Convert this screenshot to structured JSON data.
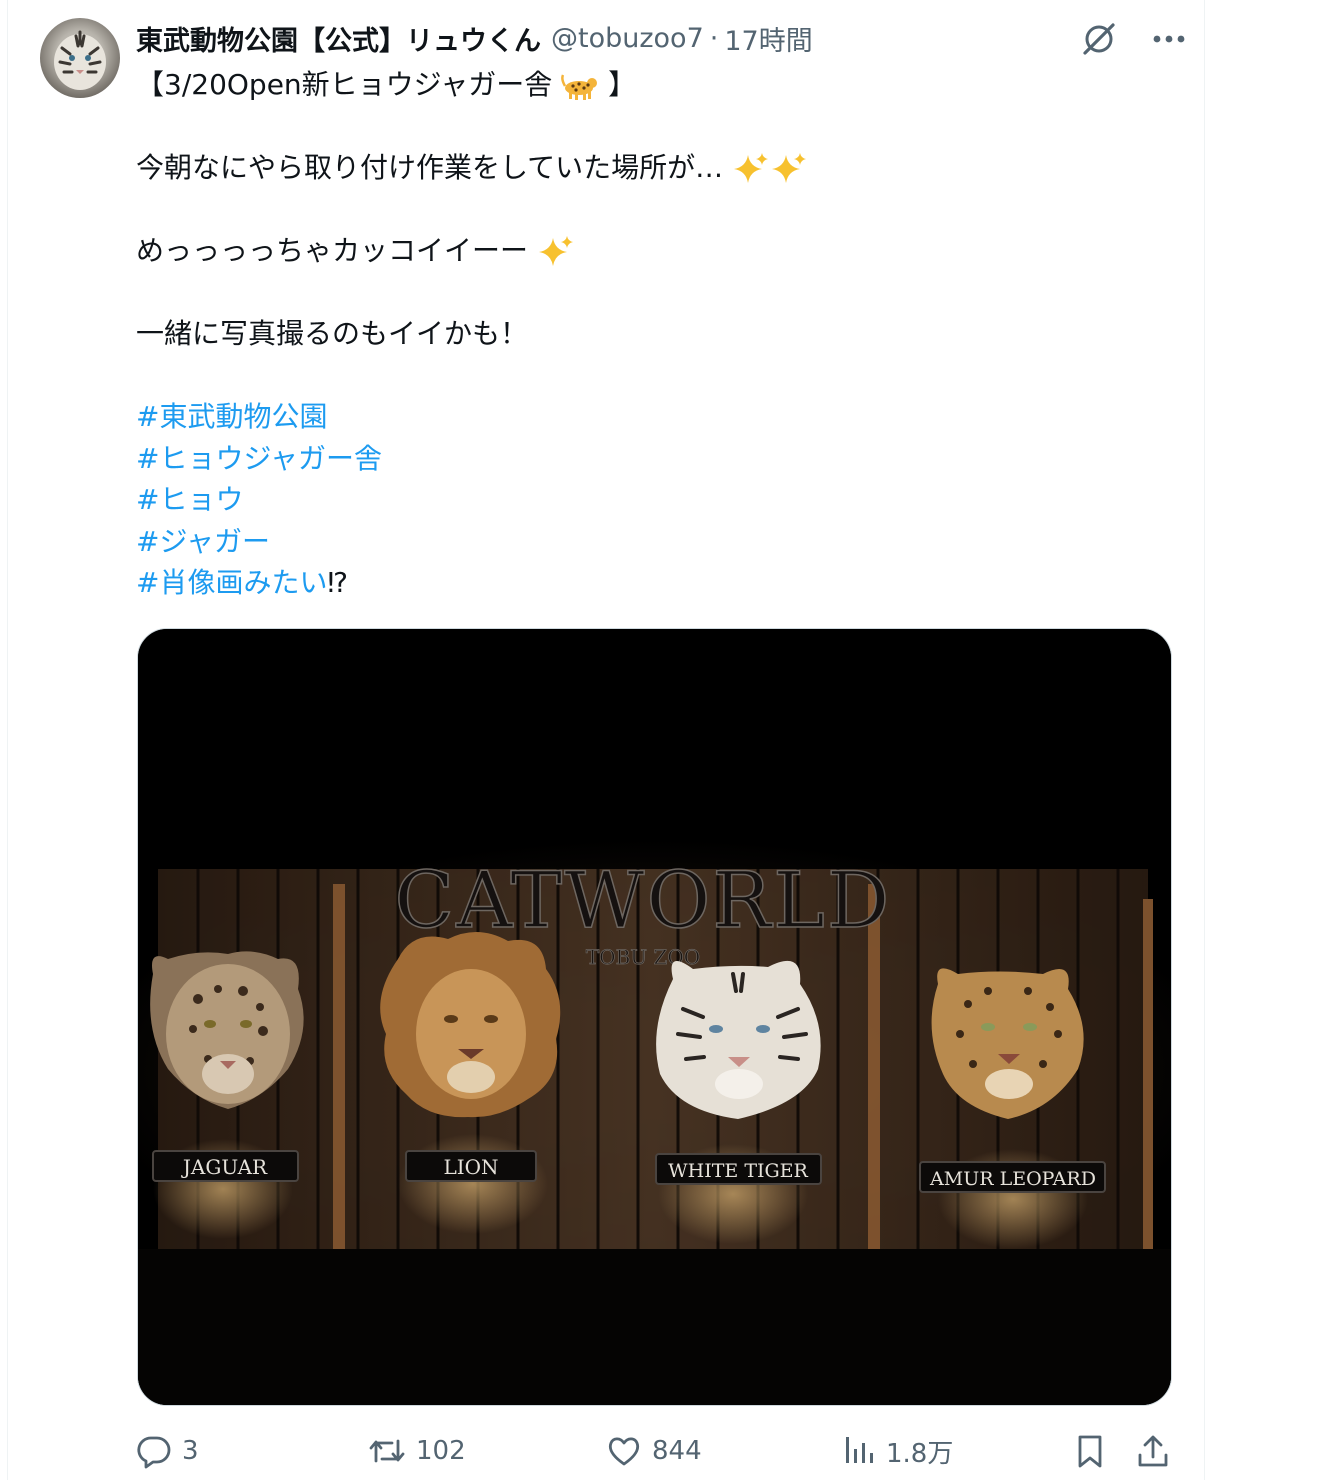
{
  "tweet": {
    "display_name": "東武動物公園【公式】リュウくん",
    "handle": "@tobuzoo7",
    "separator": "·",
    "timestamp": "17時間",
    "icons": {
      "avatar": "white-tiger-avatar",
      "grok": "grok-icon",
      "more": "more-icon"
    },
    "line1_prefix": "【3/20Open新ヒョウジャガー舎",
    "line1_emoji": "leopard-emoji",
    "line1_suffix": "】",
    "line2": "今朝なにやら取り付け作業をしていた場所が…",
    "line2_emoji": "sparkles-emoji",
    "line3": "めっっっっちゃカッコイイーー",
    "line3_emoji": "sparkles-emoji",
    "line4": "一緒に写真撮るのもイイかも！",
    "hashtags": [
      "#東武動物公園",
      "#ヒョウジャガー舎",
      "#ヒョウ",
      "#ジャガー",
      "#肖像画みたい"
    ],
    "last_suffix": "⁉"
  },
  "media": {
    "description_icon": "photo-catworld-sign",
    "sign_title": "CATWORLD",
    "sign_subtitle": "TOBU ZOO",
    "plaques": [
      "JAGUAR",
      "LION",
      "WHITE TIGER",
      "AMUR LEOPARD"
    ]
  },
  "actions": {
    "reply_count": "3",
    "retweet_count": "102",
    "like_count": "844",
    "views_count": "1.8万",
    "icons": [
      "reply-icon",
      "retweet-icon",
      "like-icon",
      "views-icon",
      "bookmark-icon",
      "share-icon"
    ]
  },
  "colors": {
    "link": "#1d9bf0",
    "secondary": "#536471",
    "text": "#0f1419",
    "border": "#cfd9de"
  }
}
